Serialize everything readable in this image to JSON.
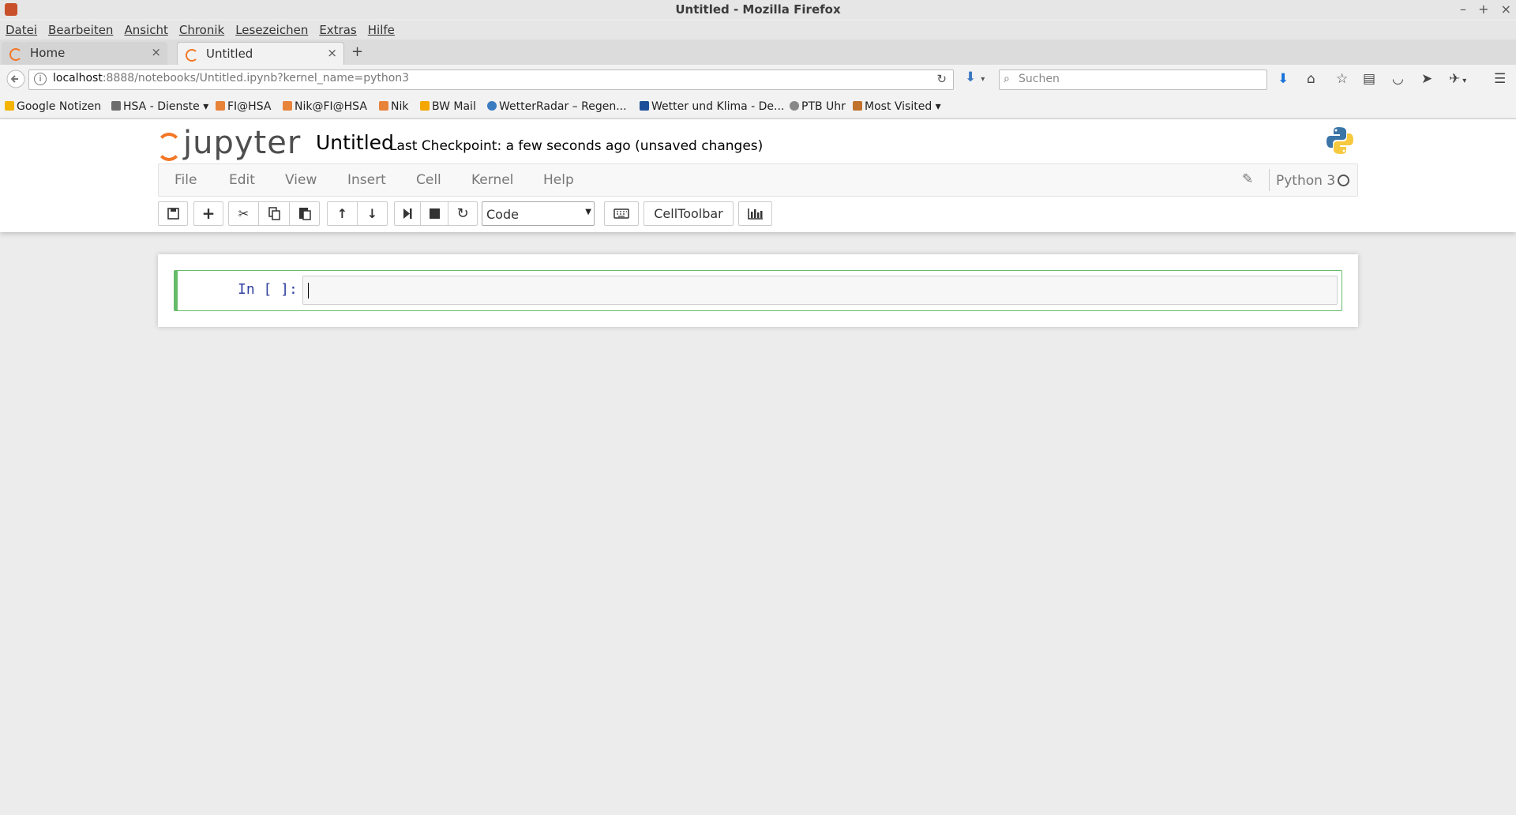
{
  "window": {
    "title": "Untitled - Mozilla Firefox",
    "controls": [
      "–",
      "+",
      "×"
    ]
  },
  "menu": [
    "Datei",
    "Bearbeiten",
    "Ansicht",
    "Chronik",
    "Lesezeichen",
    "Extras",
    "Hilfe"
  ],
  "tabs": [
    {
      "label": "Home",
      "close": "×"
    },
    {
      "label": "Untitled",
      "close": "×"
    }
  ],
  "newtab": "+",
  "address": {
    "host": "localhost",
    "rest": ":8888/notebooks/Untitled.ipynb?kernel_name=python3"
  },
  "search": {
    "placeholder": "Suchen"
  },
  "bookmarks": [
    {
      "label": "Google Notizen",
      "color": "#f4b400"
    },
    {
      "label": "HSA - Dienste ▾",
      "color": "#6d6d6d"
    },
    {
      "label": "FI@HSA",
      "color": "#e8833a"
    },
    {
      "label": "Nik@FI@HSA",
      "color": "#e8833a"
    },
    {
      "label": "Nik",
      "color": "#e8833a"
    },
    {
      "label": "BW Mail",
      "color": "#f4a700"
    },
    {
      "label": "WetterRadar – Regen...",
      "color": "#3b7bbf"
    },
    {
      "label": "Wetter und Klima - De...",
      "color": "#1f4e99"
    },
    {
      "label": "PTB Uhr",
      "color": "#888888"
    },
    {
      "label": "Most Visited ▾",
      "color": "#c1712b"
    }
  ],
  "jupyter": {
    "logo_text": "jupyter",
    "notebook_name": "Untitled",
    "checkpoint": "Last Checkpoint: a few seconds ago (unsaved changes)",
    "menu": [
      "File",
      "Edit",
      "View",
      "Insert",
      "Cell",
      "Kernel",
      "Help"
    ],
    "kernel_name": "Python 3",
    "cell_type": "Code",
    "celltoolbar_label": "CellToolbar",
    "prompt": "In [ ]:"
  },
  "colors": {
    "accent": "#f37726",
    "cell_border": "#66bb6a",
    "prompt": "#303f9f"
  }
}
